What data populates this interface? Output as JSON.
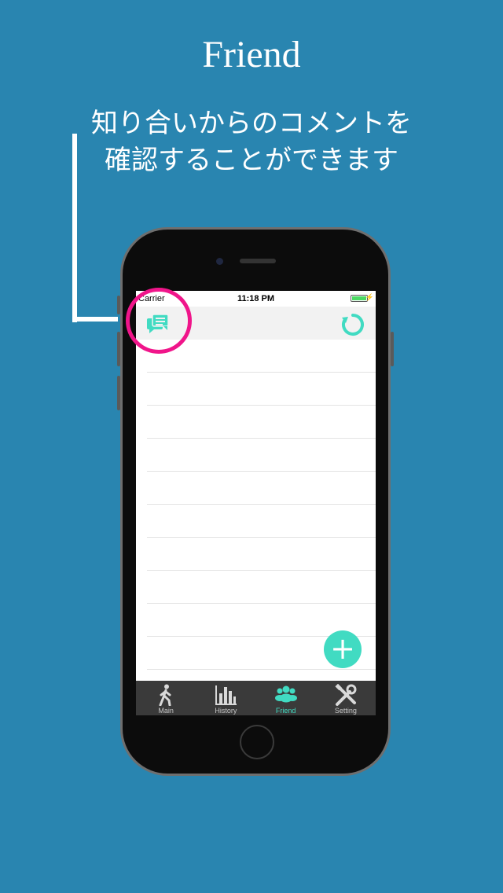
{
  "headline": "Friend",
  "subtitle_lines": [
    "知り合いからのコメントを",
    "確認することができます"
  ],
  "status": {
    "carrier": "Carrier",
    "time": "11:18 PM"
  },
  "tabs": [
    {
      "label": "Main",
      "icon": "walking-person-icon",
      "active": false
    },
    {
      "label": "History",
      "icon": "bar-chart-icon",
      "active": false
    },
    {
      "label": "Friend",
      "icon": "group-people-icon",
      "active": true
    },
    {
      "label": "Setting",
      "icon": "tools-icon",
      "active": false
    }
  ],
  "colors": {
    "background": "#2985b0",
    "accent": "#41dbc2",
    "highlight": "#f0158a",
    "tabbar": "#3a3a3a"
  }
}
